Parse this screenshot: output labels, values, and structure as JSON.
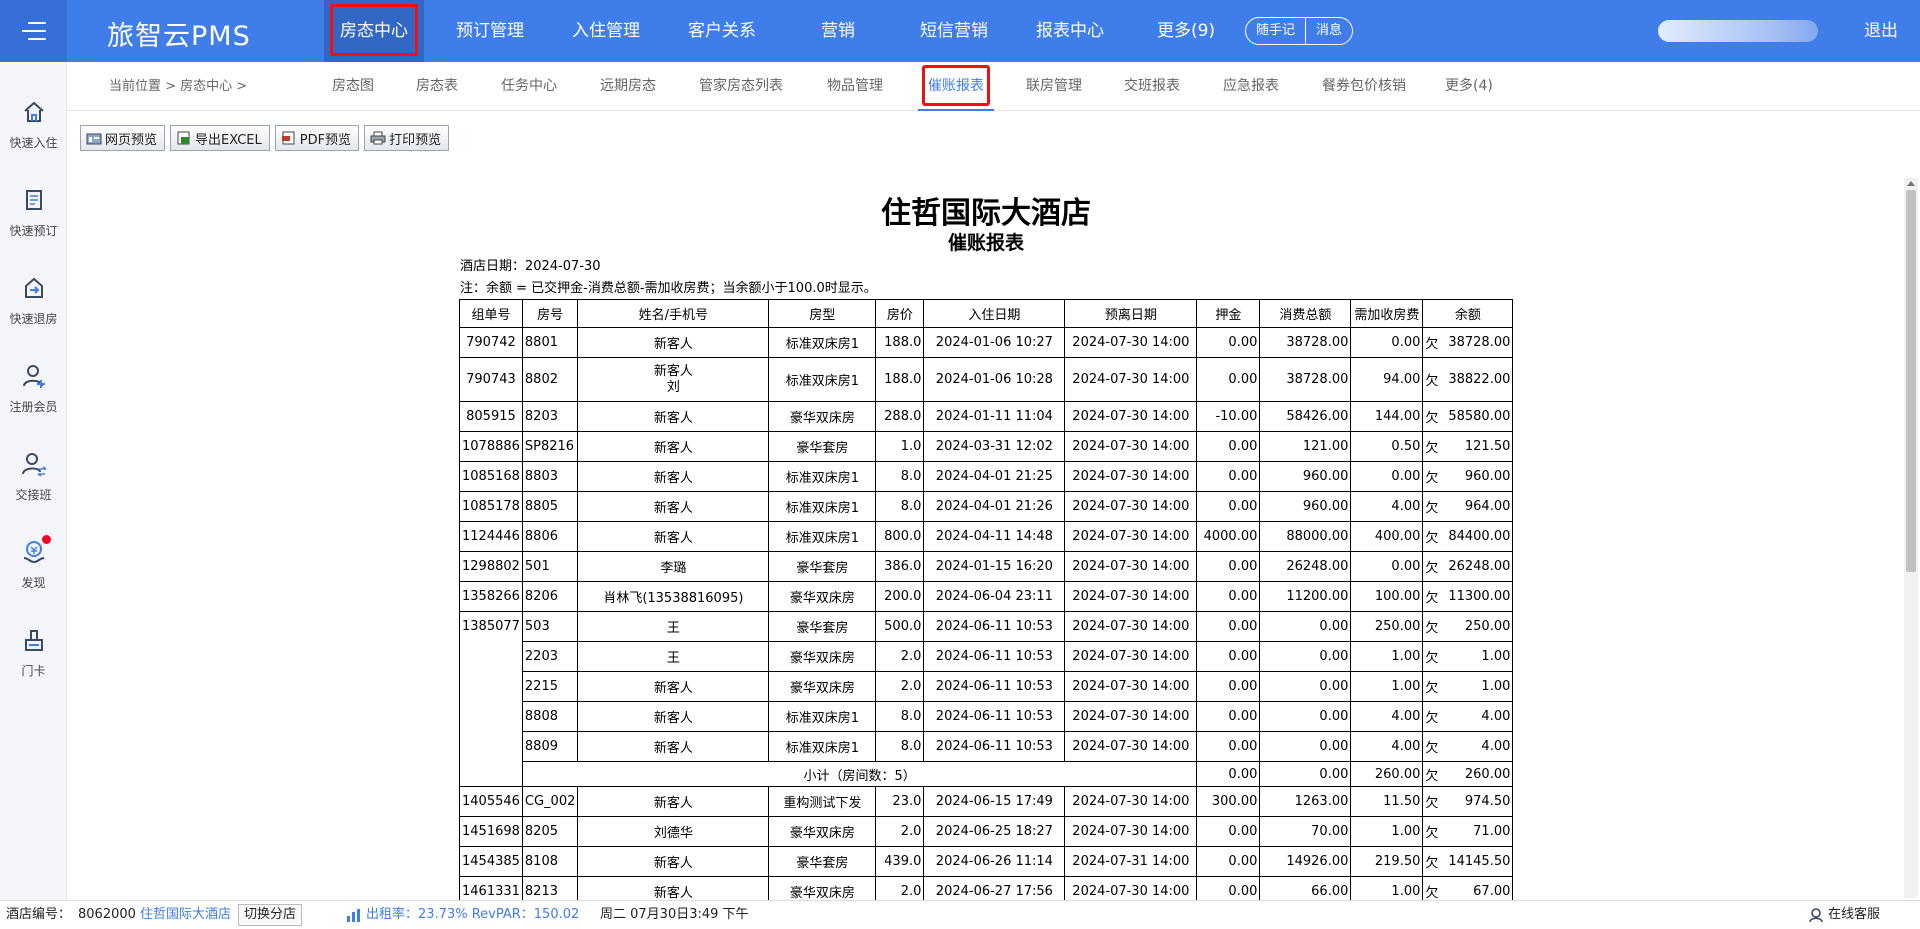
{
  "app": {
    "logo": "旅智云PMS",
    "logout": "退出"
  },
  "nav": [
    {
      "label": "房态中心"
    },
    {
      "label": "预订管理"
    },
    {
      "label": "入住管理"
    },
    {
      "label": "客户关系"
    },
    {
      "label": "营销"
    },
    {
      "label": "短信营销"
    },
    {
      "label": "报表中心"
    },
    {
      "label": "更多(9)"
    }
  ],
  "quick": {
    "notes": "随手记",
    "messages": "消息"
  },
  "sidebar": [
    {
      "label": "快速入住",
      "icon": "home-icon"
    },
    {
      "label": "快速预订",
      "icon": "document-icon"
    },
    {
      "label": "快速退房",
      "icon": "checkout-icon"
    },
    {
      "label": "注册会员",
      "icon": "add-user-icon"
    },
    {
      "label": "交接班",
      "icon": "shift-swap-icon"
    },
    {
      "label": "发现",
      "icon": "discover-icon"
    },
    {
      "label": "门卡",
      "icon": "door-card-icon"
    }
  ],
  "breadcrumb": "当前位置 > 房态中心 >",
  "tabs": [
    {
      "label": "房态图"
    },
    {
      "label": "房态表"
    },
    {
      "label": "任务中心"
    },
    {
      "label": "远期房态"
    },
    {
      "label": "管家房态列表"
    },
    {
      "label": "物品管理"
    },
    {
      "label": "催账报表"
    },
    {
      "label": "联房管理"
    },
    {
      "label": "交班报表"
    },
    {
      "label": "应急报表"
    },
    {
      "label": "餐券包价核销"
    },
    {
      "label": "更多(4)"
    }
  ],
  "toolbar": {
    "web_preview": "网页预览",
    "export_excel": "导出EXCEL",
    "pdf_preview": "PDF预览",
    "print_preview": "打印预览"
  },
  "report": {
    "hotel": "住哲国际大酒店",
    "title": "催账报表",
    "date_line": "酒店日期：2024-07-30",
    "note_line": "注：余额 = 已交押金-消费总额-需加收房费；当余额小于100.0时显示。",
    "headers": [
      "组单号",
      "房号",
      "姓名/手机号",
      "房型",
      "房价",
      "入住日期",
      "预离日期",
      "押金",
      "消费总额",
      "需加收房费",
      "余额"
    ],
    "owe_mark": "欠",
    "rows": [
      {
        "group": "790742",
        "room": "8801",
        "name": "新客人",
        "name2": "",
        "type": "标准双床房1",
        "price": "188.0",
        "checkin": "2024-01-06 10:27",
        "checkout": "2024-07-30 14:00",
        "deposit": "0.00",
        "total": "38728.00",
        "extra": "0.00",
        "balance": "38728.00"
      },
      {
        "group": "790743",
        "room": "8802",
        "name": "新客人",
        "name2": "刘",
        "type": "标准双床房1",
        "price": "188.0",
        "checkin": "2024-01-06 10:28",
        "checkout": "2024-07-30 14:00",
        "deposit": "0.00",
        "total": "38728.00",
        "extra": "94.00",
        "balance": "38822.00"
      },
      {
        "group": "805915",
        "room": "8203",
        "name": "新客人",
        "name2": "",
        "type": "豪华双床房",
        "price": "288.0",
        "checkin": "2024-01-11 11:04",
        "checkout": "2024-07-30 14:00",
        "deposit": "-10.00",
        "total": "58426.00",
        "extra": "144.00",
        "balance": "58580.00"
      },
      {
        "group": "1078886",
        "room": "SP8216",
        "name": "新客人",
        "name2": "",
        "type": "豪华套房",
        "price": "1.0",
        "checkin": "2024-03-31 12:02",
        "checkout": "2024-07-30 14:00",
        "deposit": "0.00",
        "total": "121.00",
        "extra": "0.50",
        "balance": "121.50"
      },
      {
        "group": "1085168",
        "room": "8803",
        "name": "新客人",
        "name2": "",
        "type": "标准双床房1",
        "price": "8.0",
        "checkin": "2024-04-01 21:25",
        "checkout": "2024-07-30 14:00",
        "deposit": "0.00",
        "total": "960.00",
        "extra": "0.00",
        "balance": "960.00"
      },
      {
        "group": "1085178",
        "room": "8805",
        "name": "新客人",
        "name2": "",
        "type": "标准双床房1",
        "price": "8.0",
        "checkin": "2024-04-01 21:26",
        "checkout": "2024-07-30 14:00",
        "deposit": "0.00",
        "total": "960.00",
        "extra": "4.00",
        "balance": "964.00"
      },
      {
        "group": "1124446",
        "room": "8806",
        "name": "新客人",
        "name2": "",
        "type": "标准双床房1",
        "price": "800.0",
        "checkin": "2024-04-11 14:48",
        "checkout": "2024-07-30 14:00",
        "deposit": "4000.00",
        "total": "88000.00",
        "extra": "400.00",
        "balance": "84400.00"
      },
      {
        "group": "1298802",
        "room": "501",
        "name": "李璐",
        "name2": "",
        "type": "豪华套房",
        "price": "386.0",
        "checkin": "2024-01-15 16:20",
        "checkout": "2024-07-30 14:00",
        "deposit": "0.00",
        "total": "26248.00",
        "extra": "0.00",
        "balance": "26248.00"
      },
      {
        "group": "1358266",
        "room": "8206",
        "name": "肖林飞(13538816095)",
        "name2": "",
        "type": "豪华双床房",
        "price": "200.0",
        "checkin": "2024-06-04 23:11",
        "checkout": "2024-07-30 14:00",
        "deposit": "0.00",
        "total": "11200.00",
        "extra": "100.00",
        "balance": "11300.00"
      },
      {
        "group": "1385077",
        "room": "503",
        "name": "王",
        "name2": "",
        "type": "豪华套房",
        "price": "500.0",
        "checkin": "2024-06-11 10:53",
        "checkout": "2024-07-30 14:00",
        "deposit": "0.00",
        "total": "0.00",
        "extra": "250.00",
        "balance": "250.00"
      },
      {
        "group": "",
        "room": "2203",
        "name": "王",
        "name2": "",
        "type": "豪华双床房",
        "price": "2.0",
        "checkin": "2024-06-11 10:53",
        "checkout": "2024-07-30 14:00",
        "deposit": "0.00",
        "total": "0.00",
        "extra": "1.00",
        "balance": "1.00"
      },
      {
        "group": "",
        "room": "2215",
        "name": "新客人",
        "name2": "",
        "type": "豪华双床房",
        "price": "2.0",
        "checkin": "2024-06-11 10:53",
        "checkout": "2024-07-30 14:00",
        "deposit": "0.00",
        "total": "0.00",
        "extra": "1.00",
        "balance": "1.00"
      },
      {
        "group": "",
        "room": "8808",
        "name": "新客人",
        "name2": "",
        "type": "标准双床房1",
        "price": "8.0",
        "checkin": "2024-06-11 10:53",
        "checkout": "2024-07-30 14:00",
        "deposit": "0.00",
        "total": "0.00",
        "extra": "4.00",
        "balance": "4.00"
      },
      {
        "group": "",
        "room": "8809",
        "name": "新客人",
        "name2": "",
        "type": "标准双床房1",
        "price": "8.0",
        "checkin": "2024-06-11 10:53",
        "checkout": "2024-07-30 14:00",
        "deposit": "0.00",
        "total": "0.00",
        "extra": "4.00",
        "balance": "4.00"
      }
    ],
    "subtotal": {
      "label": "小计（房间数：5）",
      "deposit": "0.00",
      "total": "0.00",
      "extra": "260.00",
      "balance": "260.00"
    },
    "rows2": [
      {
        "group": "1405546",
        "room": "CG_002",
        "name": "新客人",
        "type": "重构测试下发",
        "price": "23.0",
        "checkin": "2024-06-15 17:49",
        "checkout": "2024-07-30 14:00",
        "deposit": "300.00",
        "total": "1263.00",
        "extra": "11.50",
        "balance": "974.50"
      },
      {
        "group": "1451698",
        "room": "8205",
        "name": "刘德华",
        "type": "豪华双床房",
        "price": "2.0",
        "checkin": "2024-06-25 18:27",
        "checkout": "2024-07-30 14:00",
        "deposit": "0.00",
        "total": "70.00",
        "extra": "1.00",
        "balance": "71.00"
      },
      {
        "group": "1454385",
        "room": "8108",
        "name": "新客人",
        "type": "豪华套房",
        "price": "439.0",
        "checkin": "2024-06-26 11:14",
        "checkout": "2024-07-31 14:00",
        "deposit": "0.00",
        "total": "14926.00",
        "extra": "219.50",
        "balance": "14145.50"
      },
      {
        "group": "1461331",
        "room": "8213",
        "name": "新客人",
        "type": "豪华双床房",
        "price": "2.0",
        "checkin": "2024-06-27 17:56",
        "checkout": "2024-07-30 14:00",
        "deposit": "0.00",
        "total": "66.00",
        "extra": "1.00",
        "balance": "67.00"
      }
    ]
  },
  "status": {
    "hotel_no_label": "酒店编号：",
    "hotel_no": "8062000",
    "hotel_name": "住哲国际大酒店",
    "switch": "切换分店",
    "occupancy": "出租率：23.73% RevPAR：150.02",
    "datetime": "周二 07月30日3:49 下午",
    "support": "在线客服"
  },
  "colors": {
    "primary": "#3f7ee8",
    "highlight_border": "#ee1111"
  }
}
